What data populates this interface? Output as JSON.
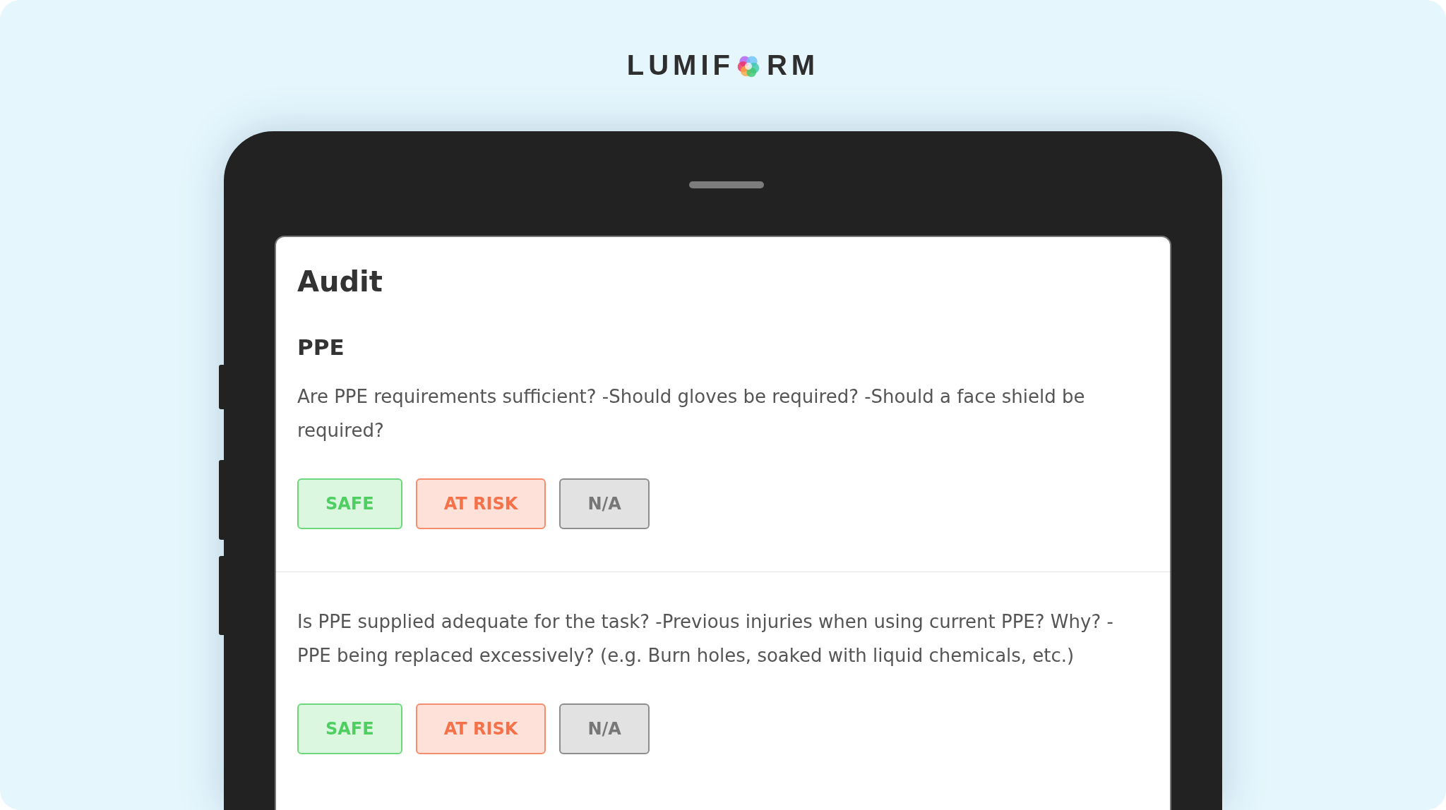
{
  "logo": {
    "before": "LUMIF",
    "after": "RM"
  },
  "form": {
    "title": "Audit",
    "section": "PPE",
    "questions": [
      {
        "text": "Are PPE requirements sufficient? -Should gloves be required? -Should a face shield be required?",
        "options": [
          {
            "label": "SAFE",
            "kind": "safe"
          },
          {
            "label": "AT RISK",
            "kind": "at_risk"
          },
          {
            "label": "N/A",
            "kind": "na"
          }
        ]
      },
      {
        "text": "Is PPE supplied adequate for the task? -Previous injuries when using current PPE? Why? -PPE being replaced excessively? (e.g. Burn holes, soaked with liquid chemicals, etc.)",
        "options": [
          {
            "label": "SAFE",
            "kind": "safe"
          },
          {
            "label": "AT RISK",
            "kind": "at_risk"
          },
          {
            "label": "N/A",
            "kind": "na"
          }
        ]
      }
    ]
  }
}
